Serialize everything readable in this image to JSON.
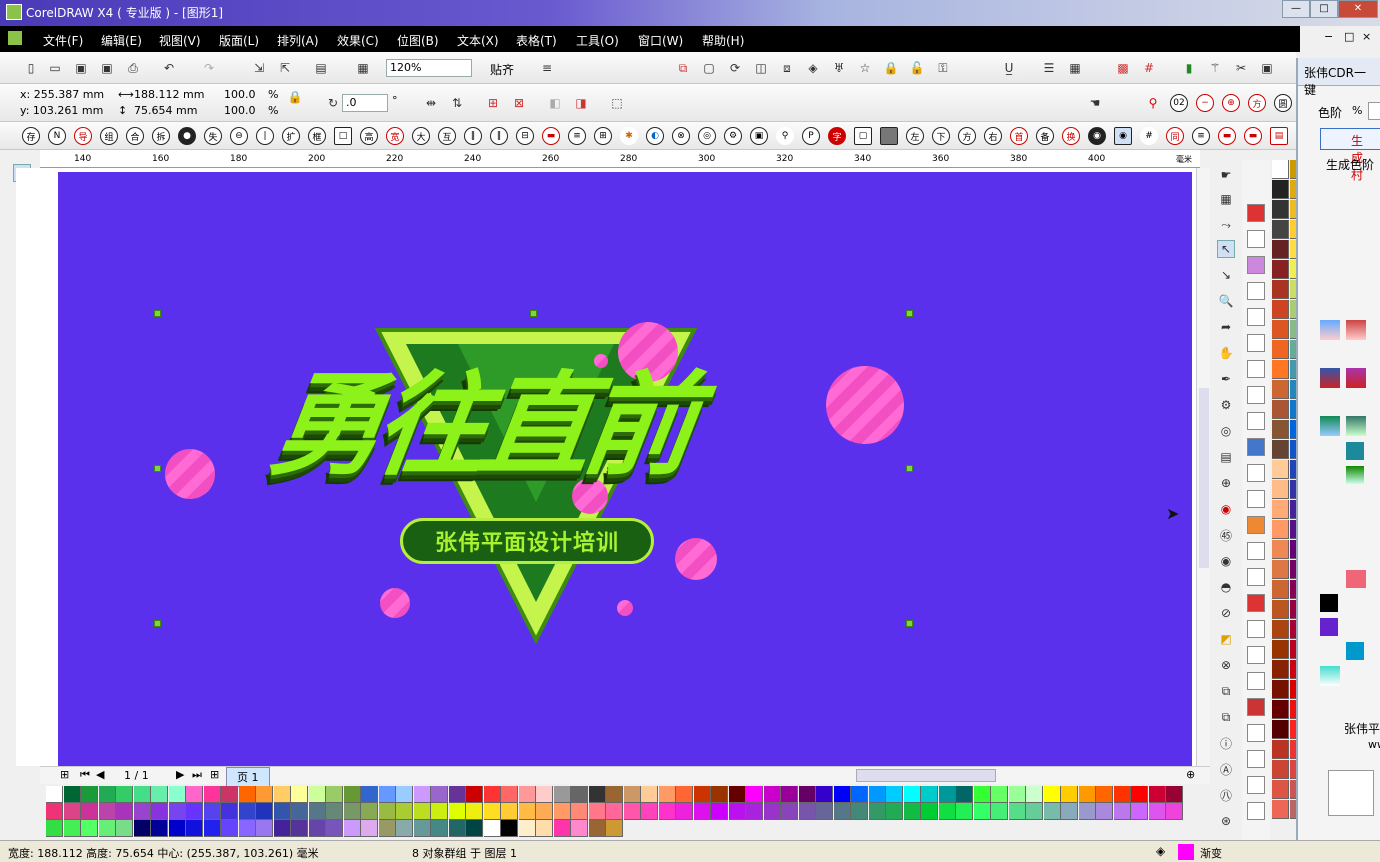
{
  "window": {
    "title": "CorelDRAW X4 ( 专业版 ) - [图形1]",
    "min": "—",
    "restore": "□",
    "close": "✕"
  },
  "menu": [
    "文件(F)",
    "编辑(E)",
    "视图(V)",
    "版面(L)",
    "排列(A)",
    "效果(C)",
    "位图(B)",
    "文本(X)",
    "表格(T)",
    "工具(O)",
    "窗口(W)",
    "帮助(H)"
  ],
  "toolbar": {
    "zoom": "120%",
    "snap": "贴齐"
  },
  "props": {
    "x": "x: 255.387 mm",
    "y": "y: 103.261 mm",
    "w": "188.112 mm",
    "h": "75.654 mm",
    "sx": "100.0",
    "sy": "100.0",
    "pct1": "%",
    "pct2": "%",
    "rot": ".0",
    "deg": "°"
  },
  "ruler": {
    "top": [
      "140",
      "160",
      "180",
      "200",
      "220",
      "240",
      "260",
      "280",
      "300",
      "320",
      "340",
      "360",
      "380",
      "400"
    ],
    "unit": "毫米",
    "left": [
      "160",
      "140",
      "120",
      "100",
      "80",
      "60",
      "40"
    ]
  },
  "artwork": {
    "headline": "勇往直前",
    "subtitle": "张伟平面设计培训"
  },
  "pagenav": {
    "count": "1 / 1",
    "tab": "页 1"
  },
  "docker": {
    "title": "张伟CDR一键",
    "label_level": "色阶",
    "pct": "%",
    "btn_gen": "生成村",
    "btn_gen2": "生成色阶",
    "footer1": "张伟平",
    "footer2": "ww"
  },
  "status": {
    "dims": "宽度: 188.112 高度: 75.654 中心: (255.387, 103.261) 毫米",
    "info": "8 对象群组 于 图层 1",
    "fill": "渐变"
  },
  "colors": {
    "page": "#5b30ec",
    "accent": "#8cf21a",
    "bubble": "#ff6ad5"
  }
}
